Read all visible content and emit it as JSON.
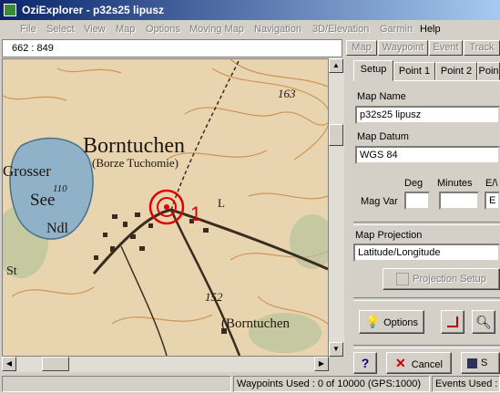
{
  "window": {
    "title": "OziExplorer - p32s25 lipusz"
  },
  "menu": [
    "File",
    "Select",
    "View",
    "Map",
    "Options",
    "Moving Map",
    "Navigation",
    "3D/Elevation",
    "Garmin",
    "Help"
  ],
  "coords": "662 : 849",
  "toolbar_tabs": [
    "Map",
    "Waypoint",
    "Event",
    "Track"
  ],
  "map_labels": {
    "town": "Borntuchen",
    "town_sub": "(Borze Tuchomie)",
    "lake1": "Grosser",
    "lake2": "See",
    "elev_lake": "110",
    "ndl": "Ndl",
    "st": "St",
    "elev1": "163",
    "elev2": "152",
    "town2": "(Borntuchen",
    "waypoint": "1",
    "l": "L"
  },
  "panel": {
    "tabs": [
      "Setup",
      "Point 1",
      "Point 2",
      "Poin"
    ],
    "map_name_label": "Map Name",
    "map_name_value": "p32s25 lipusz",
    "map_datum_label": "Map Datum",
    "map_datum_value": "WGS 84",
    "deg_label": "Deg",
    "minutes_label": "Minutes",
    "ew_label": "E/\\",
    "mag_var_label": "Mag Var",
    "ew_value": "E",
    "projection_label": "Map Projection",
    "projection_value": "Latitude/Longitude",
    "projection_setup_label": "Projection Setup",
    "options_label": "Options",
    "help_label": "?",
    "cancel_label": "Cancel",
    "save_label": "S"
  },
  "status": {
    "waypoints": "Waypoints Used : 0 of 10000  (GPS:1000)",
    "events": "Events Used :"
  }
}
